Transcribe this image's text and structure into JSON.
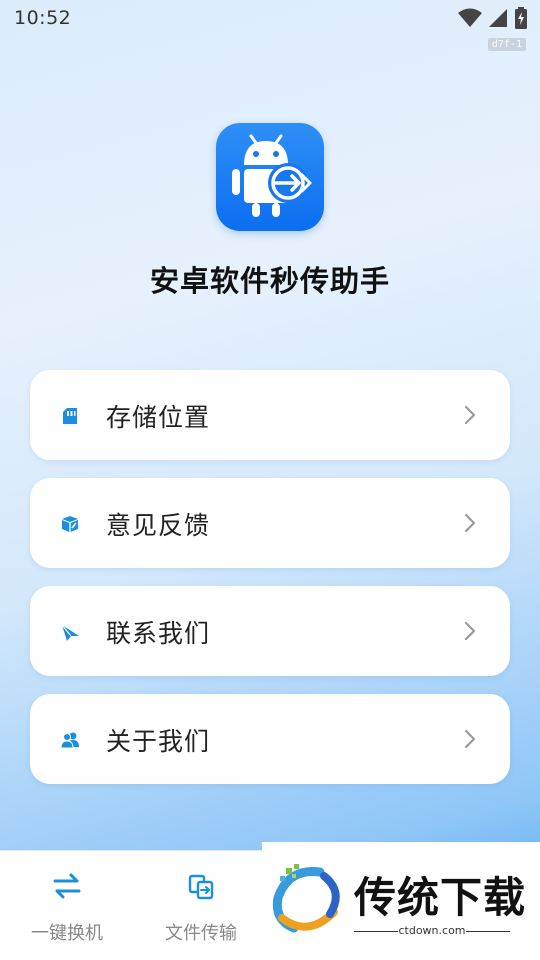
{
  "status_bar": {
    "time": "10:52",
    "icons": [
      "wifi-icon",
      "signal-icon",
      "battery-charging-icon"
    ]
  },
  "build_tag": "d7f-1",
  "app": {
    "title": "安卓软件秒传助手",
    "logo_icon": "android-transfer-icon",
    "brand_color": "#1677f0"
  },
  "menu": [
    {
      "label": "存储位置",
      "icon": "storage-icon"
    },
    {
      "label": "意见反馈",
      "icon": "feedback-icon"
    },
    {
      "label": "联系我们",
      "icon": "send-icon"
    },
    {
      "label": "关于我们",
      "icon": "users-icon"
    }
  ],
  "bottom_nav": [
    {
      "label": "一键换机",
      "icon": "swap-icon"
    },
    {
      "label": "文件传输",
      "icon": "file-transfer-icon"
    }
  ],
  "watermark": {
    "text": "传统下载",
    "url": "ctdown.com"
  },
  "colors": {
    "icon_blue": "#1a8fe0",
    "chevron": "#999999"
  }
}
